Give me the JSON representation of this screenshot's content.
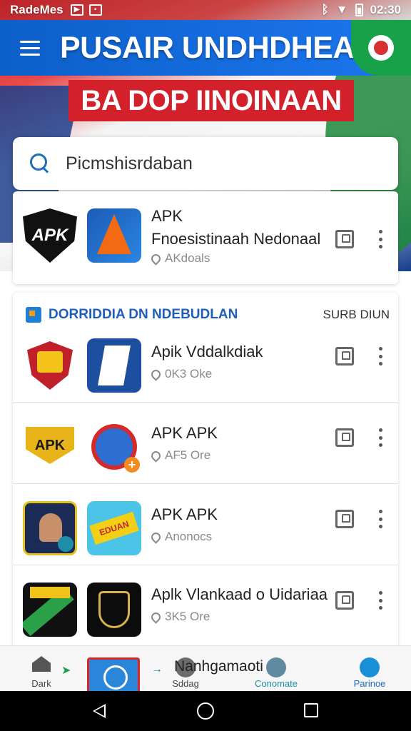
{
  "status_bar": {
    "carrier": "RadeMes",
    "time": "02:30"
  },
  "app_bar": {
    "title": "PUSAIR UNDHDHEAN"
  },
  "banner": {
    "subtitle": "BA DOP IINOINAAN"
  },
  "search": {
    "text": "Picmshisrdaban"
  },
  "featured": {
    "shield_text": "APK",
    "title": "APK",
    "subtitle": "Fnoesistinaah Nedonaal",
    "meta": "AKdoals"
  },
  "section": {
    "title": "DORRIDDIA DN NDEBUDLAN",
    "action": "SURB DIUN"
  },
  "list": [
    {
      "title": "Apik Vddalkdiak",
      "meta": "0K3 Oke"
    },
    {
      "title": "APK APK",
      "meta": "AF5 Ore",
      "badge_text": "APK"
    },
    {
      "title": "APK APK",
      "meta": "Anonocs",
      "banner_text": "EDUAN"
    },
    {
      "title": "Aplk Vlankaad o Uidariaa",
      "meta": "3K5 Ore"
    }
  ],
  "bottom_nav": {
    "home_label": "Dark",
    "second_label": "Sddag",
    "third_label": "Conomate",
    "fourth_label": "Parinoe",
    "caption": "Nanhgamaoti"
  },
  "colors": {
    "appbar_blue": "#1a73e8",
    "banner_red": "#d3212c",
    "record_green": "#17a24a",
    "section_blue": "#1f5eb8"
  },
  "icons": [
    "menu-icon",
    "record-icon",
    "search-icon",
    "bookmark-icon",
    "more-vert-icon",
    "home-icon",
    "back-icon",
    "home-circle-icon",
    "recents-icon"
  ]
}
